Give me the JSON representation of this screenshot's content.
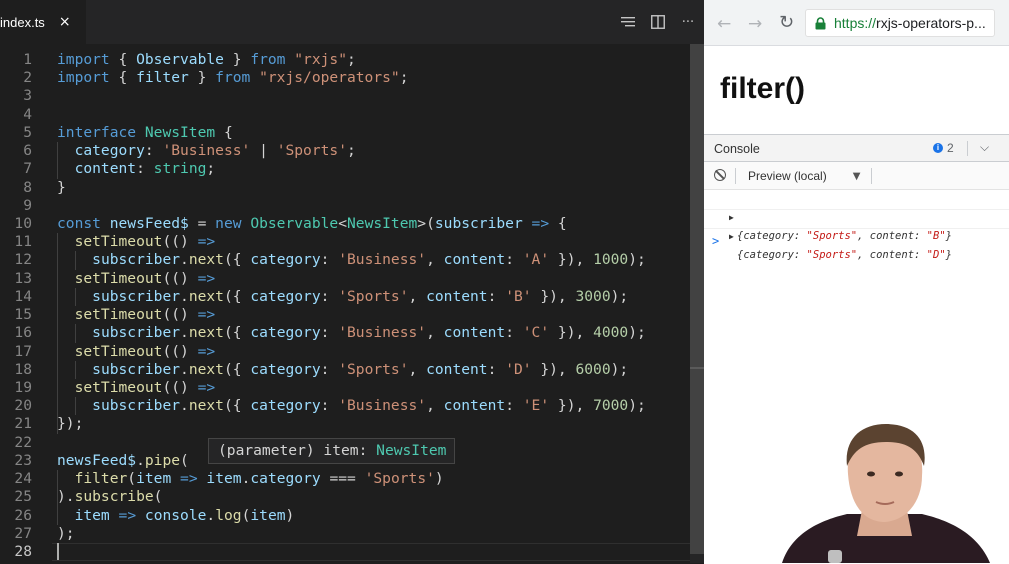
{
  "editor": {
    "tab": {
      "filename": "index.ts",
      "close": "×"
    },
    "actions": [
      "lines-icon",
      "split-editor-icon",
      "more-icon"
    ],
    "more_label": "···",
    "lines": [
      {
        "n": "1",
        "tokens": [
          [
            "k",
            "import"
          ],
          [
            "p",
            " { "
          ],
          [
            "v",
            "Observable"
          ],
          [
            "p",
            " } "
          ],
          [
            "k",
            "from"
          ],
          [
            "p",
            " "
          ],
          [
            "s",
            "\"rxjs\""
          ],
          [
            "p",
            ";"
          ]
        ]
      },
      {
        "n": "2",
        "tokens": [
          [
            "k",
            "import"
          ],
          [
            "p",
            " { "
          ],
          [
            "v",
            "filter"
          ],
          [
            "p",
            " } "
          ],
          [
            "k",
            "from"
          ],
          [
            "p",
            " "
          ],
          [
            "s",
            "\"rxjs/operators\""
          ],
          [
            "p",
            ";"
          ]
        ]
      },
      {
        "n": "3",
        "tokens": []
      },
      {
        "n": "4",
        "tokens": []
      },
      {
        "n": "5",
        "tokens": [
          [
            "k",
            "interface"
          ],
          [
            "p",
            " "
          ],
          [
            "t",
            "NewsItem"
          ],
          [
            "p",
            " {"
          ]
        ]
      },
      {
        "n": "6",
        "tokens": [
          [
            "p",
            "  "
          ],
          [
            "v",
            "category"
          ],
          [
            "p",
            ": "
          ],
          [
            "s",
            "'Business'"
          ],
          [
            "p",
            " | "
          ],
          [
            "s",
            "'Sports'"
          ],
          [
            "p",
            ";"
          ]
        ]
      },
      {
        "n": "7",
        "tokens": [
          [
            "p",
            "  "
          ],
          [
            "v",
            "content"
          ],
          [
            "p",
            ": "
          ],
          [
            "t",
            "string"
          ],
          [
            "p",
            ";"
          ]
        ]
      },
      {
        "n": "8",
        "tokens": [
          [
            "p",
            "}"
          ]
        ]
      },
      {
        "n": "9",
        "tokens": []
      },
      {
        "n": "10",
        "tokens": [
          [
            "k",
            "const"
          ],
          [
            "p",
            " "
          ],
          [
            "v",
            "newsFeed$"
          ],
          [
            "p",
            " = "
          ],
          [
            "k",
            "new"
          ],
          [
            "p",
            " "
          ],
          [
            "t",
            "Observable"
          ],
          [
            "p",
            "<"
          ],
          [
            "t",
            "NewsItem"
          ],
          [
            "p",
            ">("
          ],
          [
            "v",
            "subscriber"
          ],
          [
            "p",
            " "
          ],
          [
            "k",
            "=>"
          ],
          [
            "p",
            " {"
          ]
        ]
      },
      {
        "n": "11",
        "tokens": [
          [
            "p",
            "  "
          ],
          [
            "f",
            "setTimeout"
          ],
          [
            "p",
            "(() "
          ],
          [
            "k",
            "=>"
          ]
        ]
      },
      {
        "n": "12",
        "tokens": [
          [
            "p",
            "    "
          ],
          [
            "v",
            "subscriber"
          ],
          [
            "p",
            "."
          ],
          [
            "f",
            "next"
          ],
          [
            "p",
            "({ "
          ],
          [
            "v",
            "category"
          ],
          [
            "p",
            ": "
          ],
          [
            "s",
            "'Business'"
          ],
          [
            "p",
            ", "
          ],
          [
            "v",
            "content"
          ],
          [
            "p",
            ": "
          ],
          [
            "s",
            "'A'"
          ],
          [
            "p",
            " }), "
          ],
          [
            "n",
            "1000"
          ],
          [
            "p",
            ");"
          ]
        ]
      },
      {
        "n": "13",
        "tokens": [
          [
            "p",
            "  "
          ],
          [
            "f",
            "setTimeout"
          ],
          [
            "p",
            "(() "
          ],
          [
            "k",
            "=>"
          ]
        ]
      },
      {
        "n": "14",
        "tokens": [
          [
            "p",
            "    "
          ],
          [
            "v",
            "subscriber"
          ],
          [
            "p",
            "."
          ],
          [
            "f",
            "next"
          ],
          [
            "p",
            "({ "
          ],
          [
            "v",
            "category"
          ],
          [
            "p",
            ": "
          ],
          [
            "s",
            "'Sports'"
          ],
          [
            "p",
            ", "
          ],
          [
            "v",
            "content"
          ],
          [
            "p",
            ": "
          ],
          [
            "s",
            "'B'"
          ],
          [
            "p",
            " }), "
          ],
          [
            "n",
            "3000"
          ],
          [
            "p",
            ");"
          ]
        ]
      },
      {
        "n": "15",
        "tokens": [
          [
            "p",
            "  "
          ],
          [
            "f",
            "setTimeout"
          ],
          [
            "p",
            "(() "
          ],
          [
            "k",
            "=>"
          ]
        ]
      },
      {
        "n": "16",
        "tokens": [
          [
            "p",
            "    "
          ],
          [
            "v",
            "subscriber"
          ],
          [
            "p",
            "."
          ],
          [
            "f",
            "next"
          ],
          [
            "p",
            "({ "
          ],
          [
            "v",
            "category"
          ],
          [
            "p",
            ": "
          ],
          [
            "s",
            "'Business'"
          ],
          [
            "p",
            ", "
          ],
          [
            "v",
            "content"
          ],
          [
            "p",
            ": "
          ],
          [
            "s",
            "'C'"
          ],
          [
            "p",
            " }), "
          ],
          [
            "n",
            "4000"
          ],
          [
            "p",
            ");"
          ]
        ]
      },
      {
        "n": "17",
        "tokens": [
          [
            "p",
            "  "
          ],
          [
            "f",
            "setTimeout"
          ],
          [
            "p",
            "(() "
          ],
          [
            "k",
            "=>"
          ]
        ]
      },
      {
        "n": "18",
        "tokens": [
          [
            "p",
            "    "
          ],
          [
            "v",
            "subscriber"
          ],
          [
            "p",
            "."
          ],
          [
            "f",
            "next"
          ],
          [
            "p",
            "({ "
          ],
          [
            "v",
            "category"
          ],
          [
            "p",
            ": "
          ],
          [
            "s",
            "'Sports'"
          ],
          [
            "p",
            ", "
          ],
          [
            "v",
            "content"
          ],
          [
            "p",
            ": "
          ],
          [
            "s",
            "'D'"
          ],
          [
            "p",
            " }), "
          ],
          [
            "n",
            "6000"
          ],
          [
            "p",
            ");"
          ]
        ]
      },
      {
        "n": "19",
        "tokens": [
          [
            "p",
            "  "
          ],
          [
            "f",
            "setTimeout"
          ],
          [
            "p",
            "(() "
          ],
          [
            "k",
            "=>"
          ]
        ]
      },
      {
        "n": "20",
        "tokens": [
          [
            "p",
            "    "
          ],
          [
            "v",
            "subscriber"
          ],
          [
            "p",
            "."
          ],
          [
            "f",
            "next"
          ],
          [
            "p",
            "({ "
          ],
          [
            "v",
            "category"
          ],
          [
            "p",
            ": "
          ],
          [
            "s",
            "'Business'"
          ],
          [
            "p",
            ", "
          ],
          [
            "v",
            "content"
          ],
          [
            "p",
            ": "
          ],
          [
            "s",
            "'E'"
          ],
          [
            "p",
            " }), "
          ],
          [
            "n",
            "7000"
          ],
          [
            "p",
            ");"
          ]
        ]
      },
      {
        "n": "21",
        "tokens": [
          [
            "p",
            "});"
          ]
        ]
      },
      {
        "n": "22",
        "tokens": []
      },
      {
        "n": "23",
        "tokens": [
          [
            "v",
            "newsFeed$"
          ],
          [
            "p",
            "."
          ],
          [
            "f",
            "pipe"
          ],
          [
            "p",
            "("
          ]
        ]
      },
      {
        "n": "24",
        "tokens": [
          [
            "p",
            "  "
          ],
          [
            "f",
            "filter"
          ],
          [
            "p",
            "("
          ],
          [
            "v",
            "item"
          ],
          [
            "p",
            " "
          ],
          [
            "k",
            "=>"
          ],
          [
            "p",
            " "
          ],
          [
            "v",
            "item"
          ],
          [
            "p",
            "."
          ],
          [
            "v",
            "category"
          ],
          [
            "p",
            " === "
          ],
          [
            "s",
            "'Sports'"
          ],
          [
            "p",
            ")"
          ]
        ]
      },
      {
        "n": "25",
        "tokens": [
          [
            "p",
            ")."
          ],
          [
            "f",
            "subscribe"
          ],
          [
            "p",
            "("
          ]
        ]
      },
      {
        "n": "26",
        "tokens": [
          [
            "p",
            "  "
          ],
          [
            "v",
            "item"
          ],
          [
            "p",
            " "
          ],
          [
            "k",
            "=>"
          ],
          [
            "p",
            " "
          ],
          [
            "v",
            "console"
          ],
          [
            "p",
            "."
          ],
          [
            "f",
            "log"
          ],
          [
            "p",
            "("
          ],
          [
            "v",
            "item"
          ],
          [
            "p",
            ")"
          ]
        ]
      },
      {
        "n": "27",
        "tokens": [
          [
            "p",
            ");"
          ]
        ]
      },
      {
        "n": "28",
        "tokens": []
      }
    ],
    "hover": {
      "prefix": "(parameter) item: ",
      "type": "NewsItem"
    },
    "colors": {
      "keyword": "#569cd6",
      "string": "#ce9178",
      "type": "#4ec9b0",
      "number": "#b5cea8",
      "function": "#dcdcaa",
      "variable": "#9cdcfe",
      "text": "#d4d4d4"
    }
  },
  "browser": {
    "nav": {
      "back": "←",
      "forward": "→",
      "reload": "↻"
    },
    "url_scheme": "https://",
    "url_rest": "rxjs-operators-p...",
    "page_title": "filter()",
    "devtools": {
      "tab": "Console",
      "issues_count": "2",
      "chevron": "⌵",
      "context": "Preview (local)",
      "context_arrow": "▼",
      "logs": [
        {
          "prefix": "{category: ",
          "category": "\"Sports\"",
          "mid": ", content: ",
          "content": "\"B\"",
          "suffix": "}"
        },
        {
          "prefix": "{category: ",
          "category": "\"Sports\"",
          "mid": ", content: ",
          "content": "\"D\"",
          "suffix": "}"
        }
      ],
      "expand_arrow": "▶",
      "prompt": ">"
    }
  }
}
